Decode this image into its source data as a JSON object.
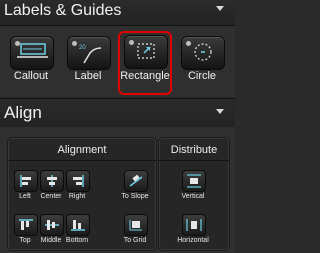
{
  "labels_guides": {
    "title": "Labels & Guides",
    "tools": [
      {
        "label": "Callout",
        "icon": "callout-icon"
      },
      {
        "label": "Label",
        "icon": "label-icon"
      },
      {
        "label": "Rectangle",
        "icon": "rectangle-guide-icon",
        "selected": true
      },
      {
        "label": "Circle",
        "icon": "circle-guide-icon"
      }
    ]
  },
  "align": {
    "title": "Align",
    "alignment": {
      "title": "Alignment",
      "buttons": [
        {
          "label": "Left",
          "icon": "align-left-icon"
        },
        {
          "label": "Center",
          "icon": "align-center-icon"
        },
        {
          "label": "Right",
          "icon": "align-right-icon"
        },
        {
          "label": "To Slope",
          "icon": "align-to-slope-icon"
        },
        {
          "label": "Top",
          "icon": "align-top-icon"
        },
        {
          "label": "Middle",
          "icon": "align-middle-icon"
        },
        {
          "label": "Bottom",
          "icon": "align-bottom-icon"
        },
        {
          "label": "To Grid",
          "icon": "align-to-grid-icon"
        }
      ]
    },
    "distribute": {
      "title": "Distribute",
      "buttons": [
        {
          "label": "Vertical",
          "icon": "distribute-vertical-icon"
        },
        {
          "label": "Horizontal",
          "icon": "distribute-horizontal-icon"
        }
      ]
    }
  },
  "colors": {
    "selection_outline": "#e00000",
    "icon_accent": "#6fd0e8"
  }
}
